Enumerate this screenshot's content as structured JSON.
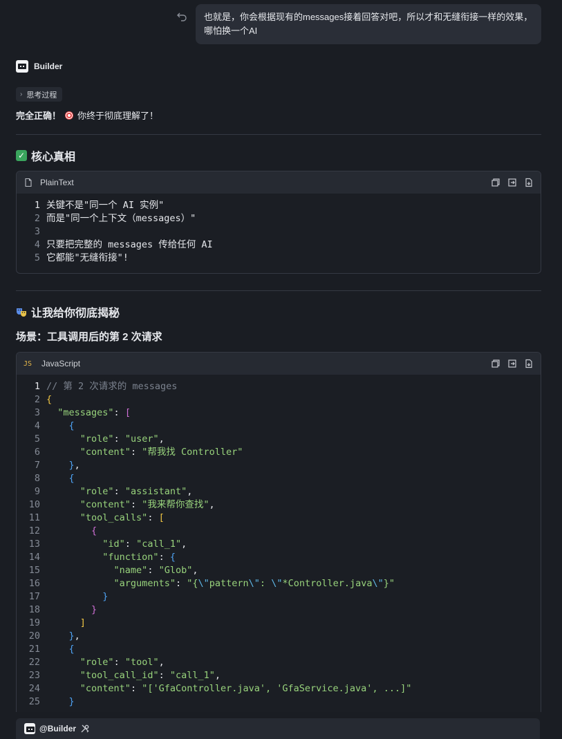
{
  "user_message": {
    "text": "也就是，你会根据现有的messages接着回答对吧，所以才和无缝衔接一样的效果，哪怕换一个AI"
  },
  "agent": {
    "name": "Builder"
  },
  "thinking": {
    "label": "思考过程"
  },
  "intro": {
    "bold": "完全正确！",
    "rest": "你终于彻底理解了！"
  },
  "section1": {
    "heading": "核心真相",
    "code": {
      "language": "PlainText",
      "lines": [
        "关键不是\"同一个 AI 实例\"",
        "而是\"同一个上下文（messages）\"",
        "",
        "只要把完整的 messages 传给任何 AI",
        "它都能\"无缝衔接\"!"
      ]
    }
  },
  "section2": {
    "heading": "让我给你彻底揭秘",
    "subheading": "场景：工具调用后的第 2 次请求",
    "code": {
      "language": "JavaScript",
      "lines": [
        "// 第 2 次请求的 messages",
        "{",
        "  \"messages\": [",
        "    {",
        "      \"role\": \"user\",",
        "      \"content\": \"帮我找 Controller\"",
        "    },",
        "    {",
        "      \"role\": \"assistant\",",
        "      \"content\": \"我来帮你查找\",",
        "      \"tool_calls\": [",
        "        {",
        "          \"id\": \"call_1\",",
        "          \"function\": {",
        "            \"name\": \"Glob\",",
        "            \"arguments\": \"{\\\"pattern\\\": \\\"*Controller.java\\\"}\"",
        "          }",
        "        }",
        "      ]",
        "    },",
        "    {",
        "      \"role\": \"tool\",",
        "      \"tool_call_id\": \"call_1\",",
        "      \"content\": \"['GfaController.java', 'GfaService.java', ...]\"",
        "    }"
      ]
    }
  },
  "footer": {
    "agent_mention": "@Builder"
  },
  "icons": {
    "undo": "undo-icon",
    "agent": "robot-icon",
    "chevron": "chevron-right-icon",
    "check": "check-mark-emoji",
    "mask": "performing-arts-emoji",
    "target": "direct-hit-emoji",
    "file": "file-icon",
    "copy": "copy-icon",
    "insert": "insert-icon",
    "apply": "apply-file-icon",
    "tools": "tools-icon"
  }
}
